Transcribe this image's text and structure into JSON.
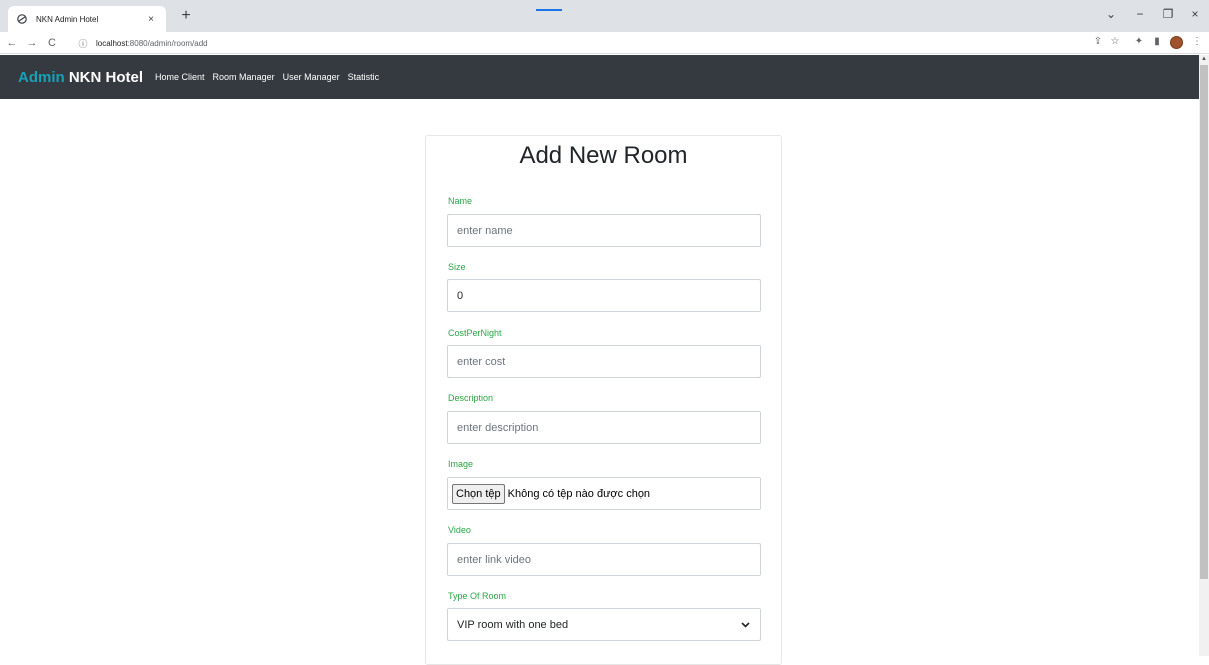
{
  "browser": {
    "tab_title": "NKN Admin Hotel",
    "tab_close": "×",
    "new_tab": "+",
    "url_host": "localhost",
    "url_path": ":8080/admin/room/add",
    "back": "←",
    "forward": "→",
    "reload": "C",
    "info": "ⓘ",
    "window_controls": {
      "list": "⌄",
      "minimize": "−",
      "restore": "❐",
      "close": "×"
    },
    "toolbar_icons": {
      "share": "⇪",
      "bookmark": "☆",
      "extensions": "✦",
      "sidepanel": "▮",
      "menu": "⋮"
    }
  },
  "navbar": {
    "brand_admin": "Admin",
    "brand_name": "NKN Hotel",
    "links": [
      "Home Client",
      "Room Manager",
      "User Manager",
      "Statistic"
    ]
  },
  "form": {
    "title": "Add New Room",
    "fields": [
      {
        "label": "Name",
        "placeholder": "enter name"
      },
      {
        "label": "Size",
        "value": "0"
      },
      {
        "label": "CostPerNight",
        "placeholder": "enter cost"
      },
      {
        "label": "Description",
        "placeholder": "enter description"
      },
      {
        "label": "Image",
        "file_button": "Chọn tệp",
        "file_status": "Không có tệp nào được chọn"
      },
      {
        "label": "Video",
        "placeholder": "enter link video"
      },
      {
        "label": "Type Of Room",
        "selected": "VIP room with one bed"
      }
    ]
  },
  "colors": {
    "navbar_bg": "#343a40",
    "brand_accent": "#17a2b8",
    "label_green": "#28a745"
  }
}
